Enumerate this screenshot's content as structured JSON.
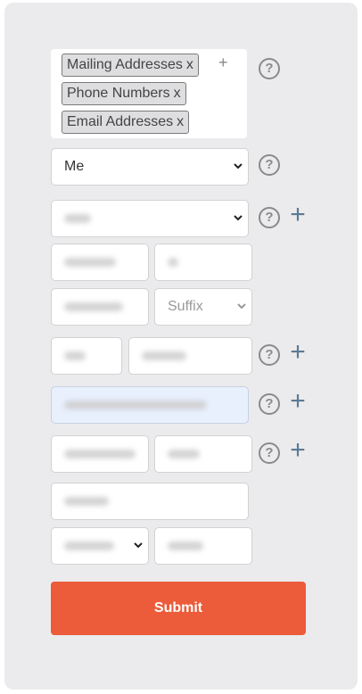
{
  "tags": [
    {
      "label": "Mailing Addresses",
      "remove": "x"
    },
    {
      "label": "Phone Numbers",
      "remove": "x"
    },
    {
      "label": "Email Addresses",
      "remove": "x"
    }
  ],
  "tag_add_symbol": "+",
  "recipient_select": {
    "value": "Me"
  },
  "suffix_select": {
    "placeholder": "Suffix"
  },
  "help_symbol": "?",
  "add_symbol": "+",
  "submit_label": "Submit",
  "colors": {
    "submit": "#ec5b3a",
    "add_icon": "#5b7a94",
    "email_bg": "#e8f0fe"
  }
}
